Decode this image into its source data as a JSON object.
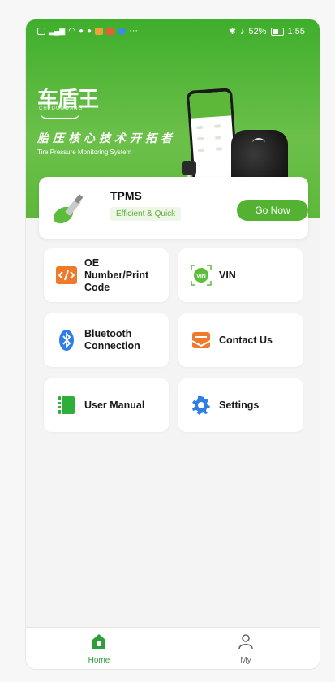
{
  "status": {
    "battery": "52%",
    "time": "1:55",
    "more": "···"
  },
  "brand": {
    "logo_zh": "车盾王",
    "logo_en": "CHEDUNWANG",
    "slogan_zh": "胎压核心技术开拓者",
    "slogan_en": "Tire Pressure Monitoring System"
  },
  "tpms": {
    "title": "TPMS",
    "tag": "Efficient & Quick",
    "button": "Go Now"
  },
  "menu": {
    "oe": "OE Number/Print Code",
    "vin": "VIN",
    "bluetooth": "Bluetooth Connection",
    "contact": "Contact Us",
    "manual": "User Manual",
    "settings": "Settings"
  },
  "tabs": {
    "home": "Home",
    "my": "My"
  },
  "colors": {
    "brand_green": "#53b232",
    "orange": "#f07a2c",
    "blue": "#2f7ee8"
  }
}
